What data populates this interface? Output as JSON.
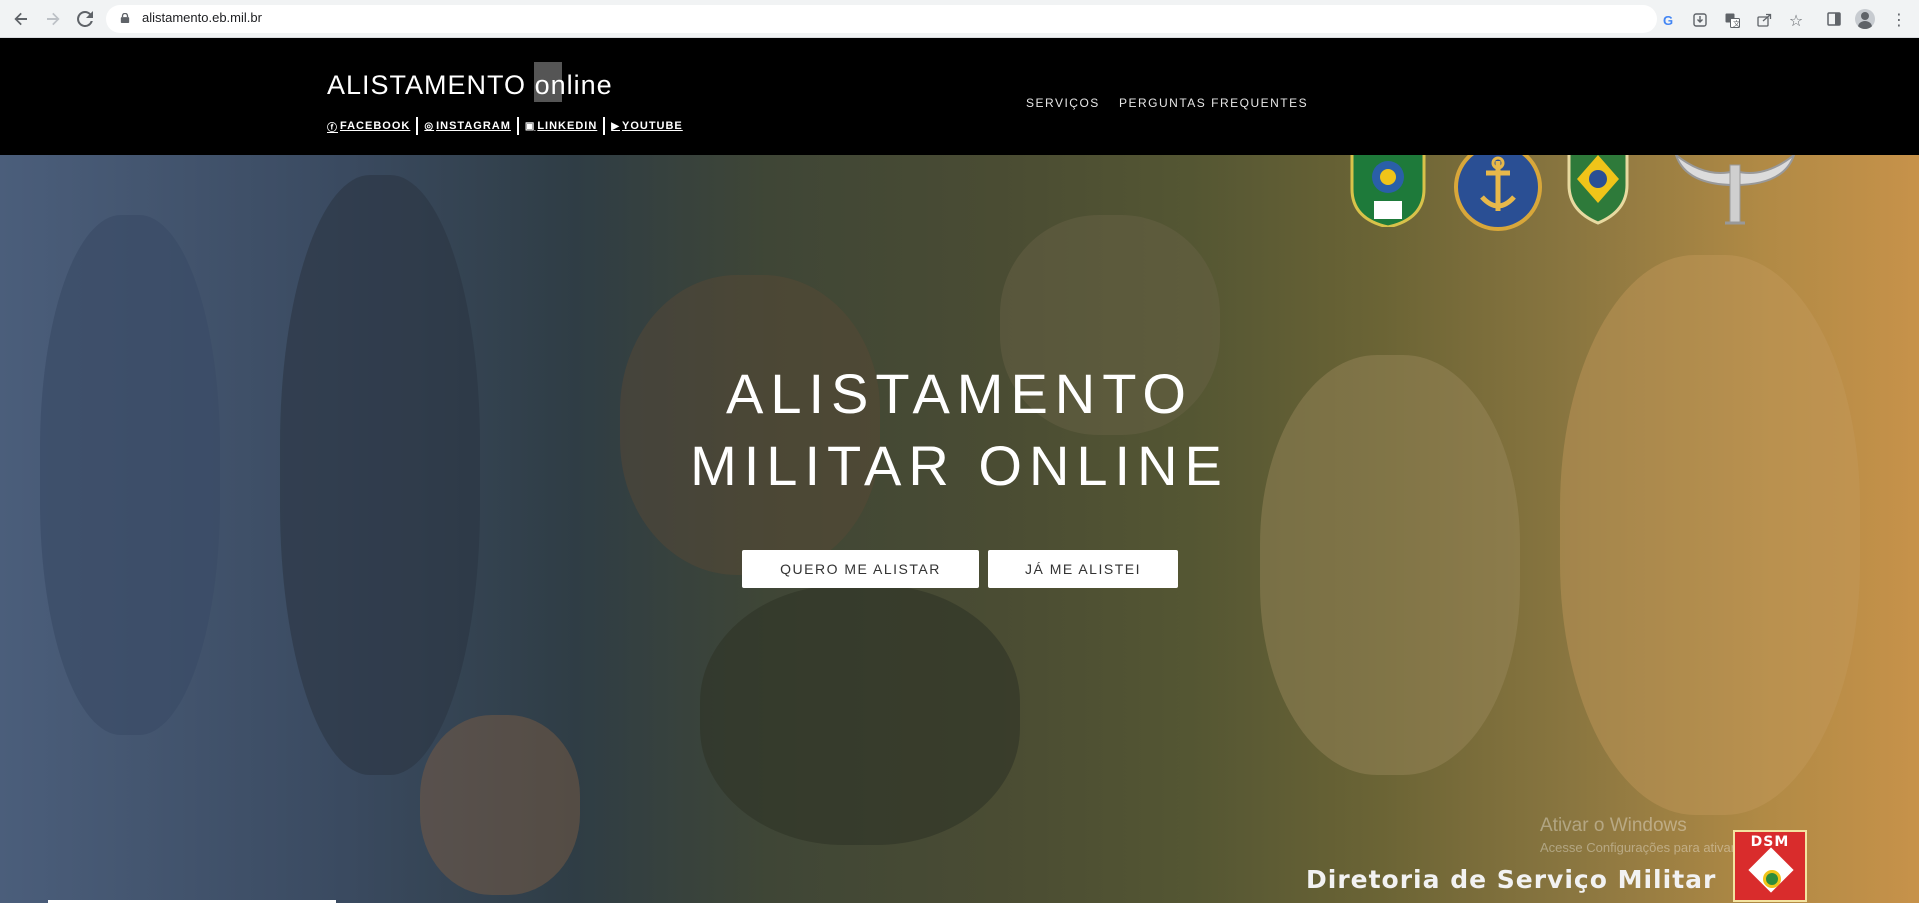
{
  "browser": {
    "url": "alistamento.eb.mil.br"
  },
  "site": {
    "logo_main": "ALISTAMENTO",
    "logo_sub": "online",
    "social": [
      {
        "icon": "facebook-icon",
        "glyph": "ⓕ",
        "label": "FACEBOOK"
      },
      {
        "icon": "instagram-icon",
        "glyph": "◎",
        "label": "INSTAGRAM"
      },
      {
        "icon": "linkedin-icon",
        "glyph": "▣",
        "label": "LINKEDIN"
      },
      {
        "icon": "youtube-icon",
        "glyph": "▶",
        "label": "YOUTUBE"
      }
    ],
    "nav": [
      "SERVIÇOS",
      "PERGUNTAS FREQUENTES"
    ]
  },
  "hero": {
    "title_line1": "ALISTAMENTO",
    "title_line2": "MILITAR ONLINE",
    "btn_enlist": "QUERO ME ALISTAR",
    "btn_enlisted": "JÁ ME ALISTEI",
    "dsm_text": "Diretoria de Serviço Militar",
    "dsm_badge": "DSM"
  },
  "watermark": {
    "title": "Ativar o Windows",
    "subtitle": "Acesse Configurações para ativar o Windows."
  }
}
